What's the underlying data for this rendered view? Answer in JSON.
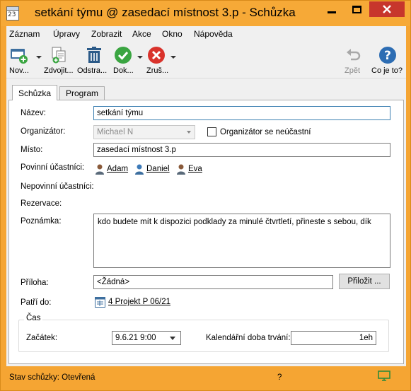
{
  "window": {
    "title": "setkání týmu @ zasedací místnost 3.p - Schůzka",
    "app_icon_number": "23",
    "colors": {
      "frame": "#f5a533",
      "close": "#c7362c"
    }
  },
  "menu": [
    "Záznam",
    "Úpravy",
    "Zobrazit",
    "Akce",
    "Okno",
    "Nápověda"
  ],
  "toolbar": {
    "new_label": "Nov...",
    "duplicate_label": "Zdvojit...",
    "delete_label": "Odstra...",
    "done_label": "Dok...",
    "cancel_label": "Zruš...",
    "undo_label": "Zpět",
    "help_label": "Co je to?"
  },
  "tabs": [
    "Schůzka",
    "Program"
  ],
  "form": {
    "name_label": "Název:",
    "name_value": "setkání týmu",
    "organizer_label": "Organizátor:",
    "organizer_value": "Michael N",
    "organizer_absent_label": "Organizátor se neúčastní",
    "place_label": "Místo:",
    "place_value": "zasedací místnost 3.p",
    "required_label": "Povinní účastníci:",
    "required_participants": [
      "Adam",
      "Daniel",
      "Eva"
    ],
    "optional_label": "Nepovinní účastníci:",
    "reservation_label": "Rezervace:",
    "note_label": "Poznámka:",
    "note_value": "kdo budete mít k dispozici podklady za minulé čtvrtletí, přineste s sebou, dík",
    "attachment_label": "Příloha:",
    "attachment_value": "<Žádná>",
    "attach_button": "Přiložit ...",
    "belongs_label": "Patří do:",
    "belongs_value": "4 Projekt P 06/21",
    "time_group_title": "Čas",
    "start_label": "Začátek:",
    "start_value": "9.6.21 9:00",
    "duration_label": "Kalendářní doba trvání:",
    "duration_value": "1eh"
  },
  "status": {
    "text": "Stav schůzky: Otevřená",
    "help_mark": "?"
  }
}
